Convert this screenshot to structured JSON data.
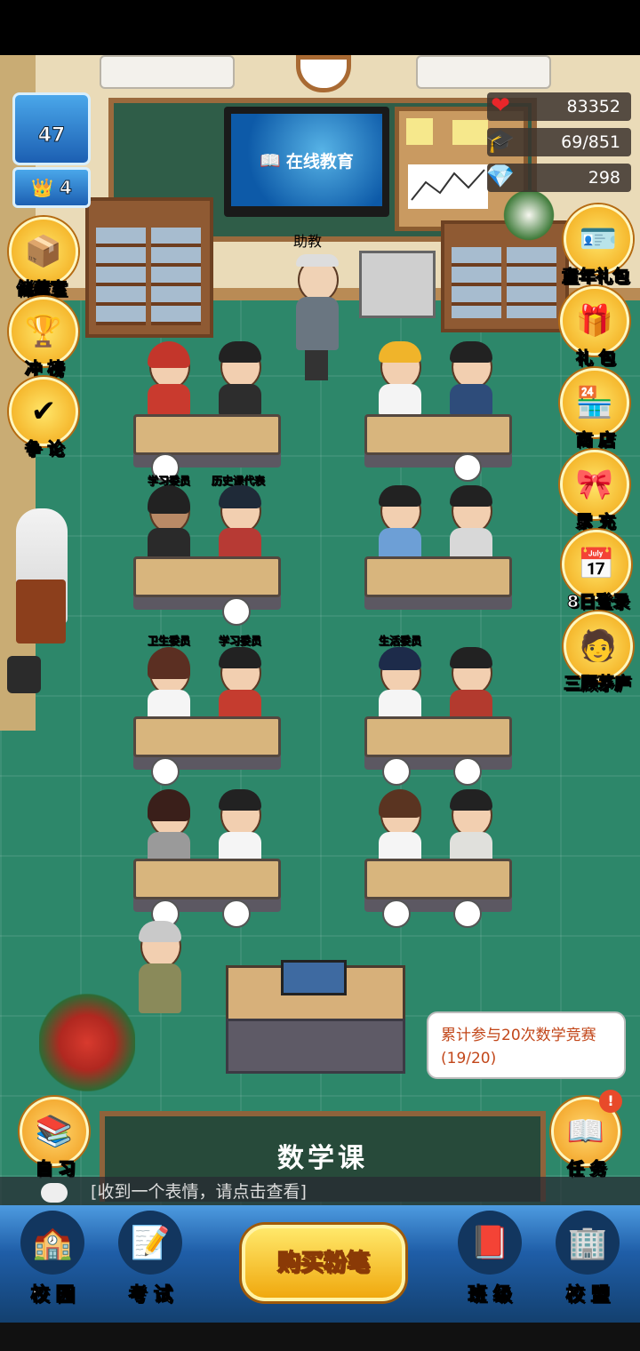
{
  "hud": {
    "level": "47",
    "crown_level": "4",
    "hearts": "83352",
    "scholar_points": "69/851",
    "gems": "298"
  },
  "tv_text": "在线教育",
  "assistant_label": "助教",
  "left_menu": [
    {
      "label": "储藏室",
      "icon": "boxes-icon"
    },
    {
      "label": "冲 榜",
      "icon": "trophy-icon"
    },
    {
      "label": "争 论",
      "icon": "debate-icon"
    }
  ],
  "right_menu": [
    {
      "label": "童年礼包",
      "icon": "id-card-icon"
    },
    {
      "label": "礼 包",
      "icon": "gift-icon"
    },
    {
      "label": "商 店",
      "icon": "shop-icon"
    },
    {
      "label": "累 充",
      "icon": "gift-box-icon"
    },
    {
      "label": "8日登录",
      "icon": "calendar-icon"
    },
    {
      "label": "三顾茅庐",
      "icon": "scholar-icon"
    }
  ],
  "student_tags": {
    "study_rep_1": "学习委员",
    "history_rep": "历史课代表",
    "health_rep": "卫生委员",
    "study_rep_2": "学习委员",
    "life_rep": "生活委员"
  },
  "task_bubble": "累计参与20次数学竞赛(19/20)",
  "self_study_label": "自 习",
  "task_label": "任 务",
  "lecture_title": "数学课",
  "chat_message": "[收到一个表情，请点击查看]",
  "bottom_nav": {
    "campus": "校 园",
    "exam": "考 试",
    "buy_chalk": "购买粉笔",
    "class": "班 级",
    "alliance": "校 盟"
  }
}
